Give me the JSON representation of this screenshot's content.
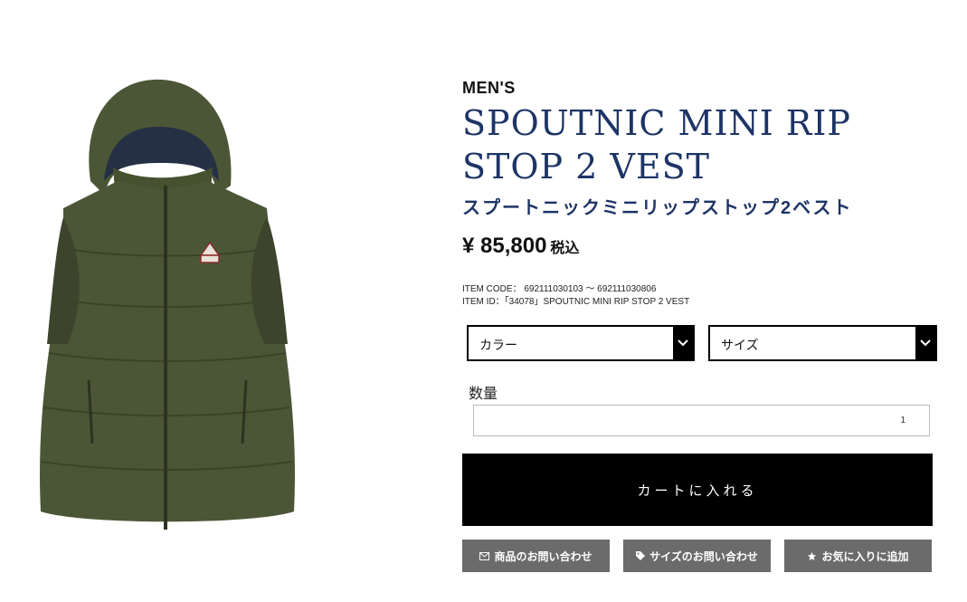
{
  "product": {
    "category": "MEN'S",
    "title": "SPOUTNIC MINI RIP STOP 2 VEST",
    "title_ja": "スプートニックミニリップストップ2ベスト",
    "price": "¥ 85,800",
    "tax_label": "税込",
    "item_code": "ITEM CODE： 692111030103 〜 692111030806",
    "item_id": "ITEM ID：「34078」SPOUTNIC MINI RIP STOP 2 VEST",
    "image_alt": "olive-green-hooded-down-vest"
  },
  "options": {
    "color_label": "カラー",
    "size_label": "サイズ"
  },
  "quantity": {
    "label": "数量",
    "value": "1"
  },
  "actions": {
    "add_to_cart": "カートに入れる",
    "product_inquiry": "商品のお問い合わせ",
    "size_inquiry": "サイズのお問い合わせ",
    "add_favorite": "お気に入りに追加"
  },
  "colors": {
    "title": "#1d3466",
    "vest": "#4b5637",
    "button_dark": "#000000",
    "button_gray": "#6b6b6b"
  },
  "icons": {
    "inquiry": "envelope-icon",
    "size": "tag-icon",
    "favorite": "star-icon",
    "select": "chevron-down-icon"
  }
}
